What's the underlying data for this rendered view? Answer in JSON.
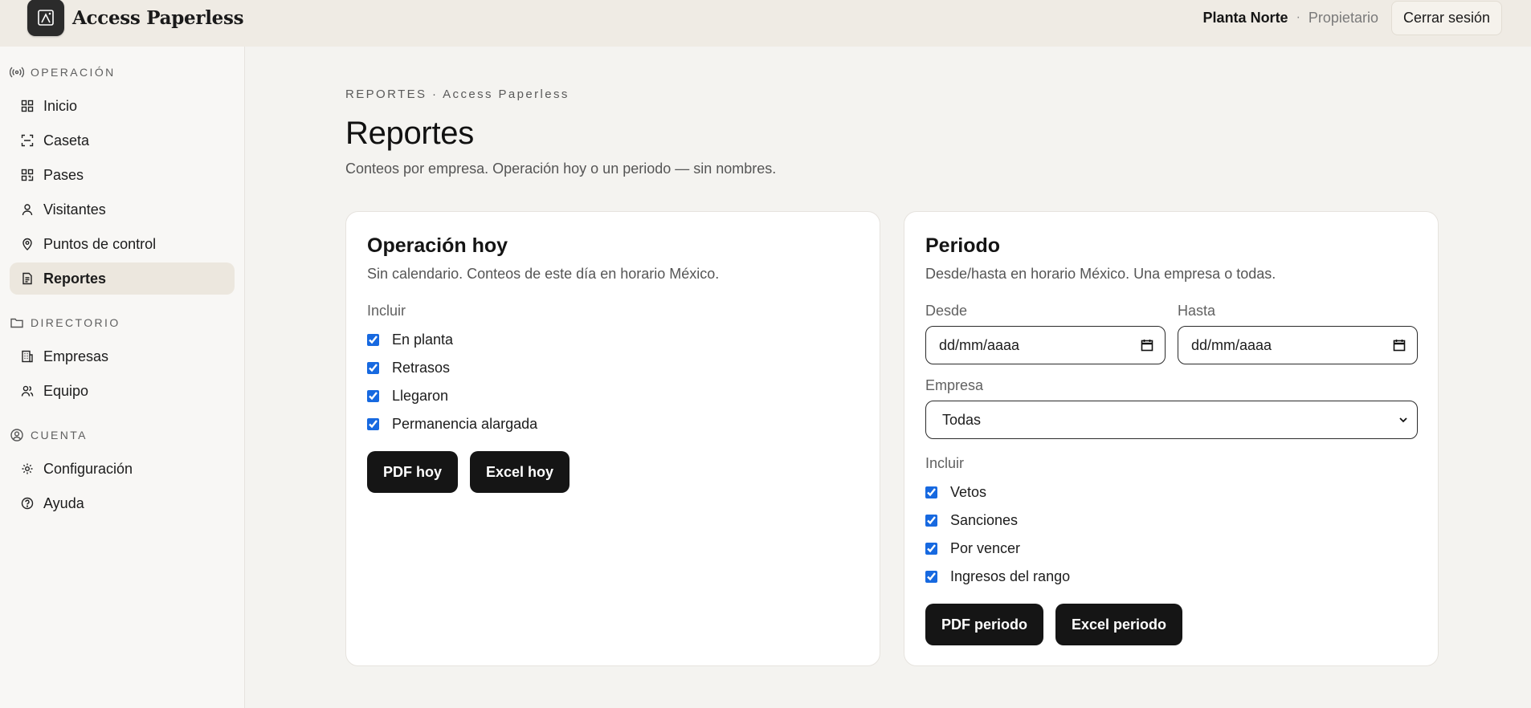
{
  "app": {
    "name": "Access Paperless"
  },
  "header": {
    "plant": "Planta Norte",
    "separator": "·",
    "role": "Propietario",
    "logout_label": "Cerrar sesión"
  },
  "sidebar": {
    "sections": [
      {
        "title": "OPERACIÓN",
        "items": [
          {
            "label": "Inicio",
            "icon": "grid-icon"
          },
          {
            "label": "Caseta",
            "icon": "scan-icon"
          },
          {
            "label": "Pases",
            "icon": "qr-icon"
          },
          {
            "label": "Visitantes",
            "icon": "user-icon"
          },
          {
            "label": "Puntos de control",
            "icon": "map-pin-icon"
          },
          {
            "label": "Reportes",
            "icon": "file-text-icon",
            "active": true
          }
        ]
      },
      {
        "title": "DIRECTORIO",
        "items": [
          {
            "label": "Empresas",
            "icon": "building-icon"
          },
          {
            "label": "Equipo",
            "icon": "users-icon"
          }
        ]
      },
      {
        "title": "CUENTA",
        "items": [
          {
            "label": "Configuración",
            "icon": "gear-icon"
          },
          {
            "label": "Ayuda",
            "icon": "help-circle-icon"
          }
        ]
      }
    ]
  },
  "page": {
    "breadcrumb": "REPORTES · Access Paperless",
    "title": "Reportes",
    "subtitle": "Conteos por empresa. Operación hoy o un periodo — sin nombres."
  },
  "today": {
    "title": "Operación hoy",
    "description": "Sin calendario. Conteos de este día en horario México.",
    "include_label": "Incluir",
    "options": [
      {
        "label": "En planta",
        "checked": true
      },
      {
        "label": "Retrasos",
        "checked": true
      },
      {
        "label": "Llegaron",
        "checked": true
      },
      {
        "label": "Permanencia alargada",
        "checked": true
      }
    ],
    "pdf_label": "PDF hoy",
    "excel_label": "Excel hoy"
  },
  "period": {
    "title": "Periodo",
    "description": "Desde/hasta en horario México. Una empresa o todas.",
    "from_label": "Desde",
    "to_label": "Hasta",
    "from_placeholder": "dd/mm/aaaa",
    "to_placeholder": "dd/mm/aaaa",
    "company_label": "Empresa",
    "company_value": "Todas",
    "include_label": "Incluir",
    "options": [
      {
        "label": "Vetos",
        "checked": true
      },
      {
        "label": "Sanciones",
        "checked": true
      },
      {
        "label": "Por vencer",
        "checked": true
      },
      {
        "label": "Ingresos del rango",
        "checked": true
      }
    ],
    "pdf_label": "PDF periodo",
    "excel_label": "Excel periodo"
  }
}
